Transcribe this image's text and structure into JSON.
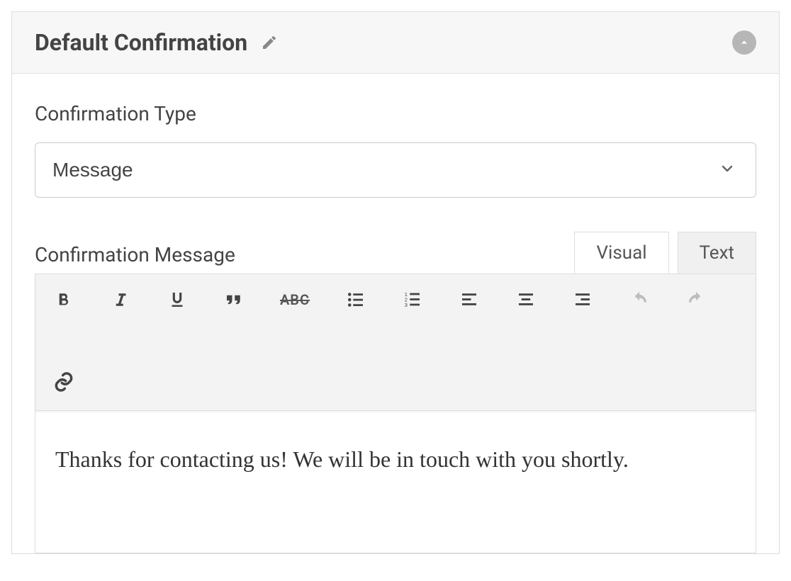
{
  "header": {
    "title": "Default Confirmation"
  },
  "confirmation_type": {
    "label": "Confirmation Type",
    "value": "Message"
  },
  "confirmation_message": {
    "label": "Confirmation Message"
  },
  "editor_tabs": {
    "visual": "Visual",
    "text": "Text",
    "active": "visual"
  },
  "editor": {
    "content": "Thanks for contacting us! We will be in touch with you shortly."
  },
  "toolbar": {
    "buttons": [
      "bold",
      "italic",
      "underline",
      "blockquote",
      "strikethrough",
      "bulleted-list",
      "numbered-list",
      "align-left",
      "align-center",
      "align-right",
      "undo",
      "redo",
      "link"
    ]
  }
}
